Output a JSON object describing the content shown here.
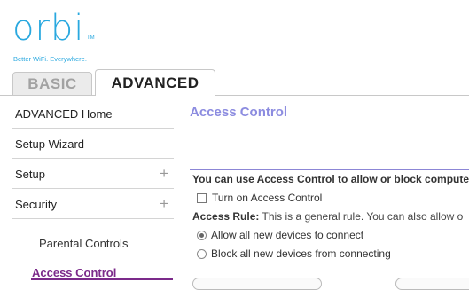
{
  "brand": {
    "logo_text": "orbi",
    "trademark": "TM",
    "tagline": "Better WiFi. Everywhere.",
    "color": "#29a8df"
  },
  "tabs": [
    {
      "label": "BASIC",
      "active": false
    },
    {
      "label": "ADVANCED",
      "active": true
    }
  ],
  "sidebar": {
    "items": [
      {
        "label": "ADVANCED Home",
        "expandable": false
      },
      {
        "label": "Setup Wizard",
        "expandable": false
      },
      {
        "label": "Setup",
        "expandable": true
      },
      {
        "label": "Security",
        "expandable": true
      }
    ],
    "plus_glyph": "+",
    "subitems": [
      {
        "label": "Parental Controls",
        "active": false
      },
      {
        "label": "Access Control",
        "active": true
      }
    ]
  },
  "main": {
    "title": "Access Control",
    "intro": "You can use Access Control to allow or block computers",
    "turn_on_label": "Turn on Access Control",
    "turn_on_checked": false,
    "rule_label": "Access Rule:",
    "rule_text": "This is a general rule. You can also allow o",
    "options": [
      {
        "label": "Allow all new devices to connect",
        "selected": true
      },
      {
        "label": "Block all new devices from connecting",
        "selected": false
      }
    ]
  },
  "colors": {
    "title": "#8c8ce0",
    "active_nav": "#7b2a8a",
    "divider": "#8c86d6"
  }
}
